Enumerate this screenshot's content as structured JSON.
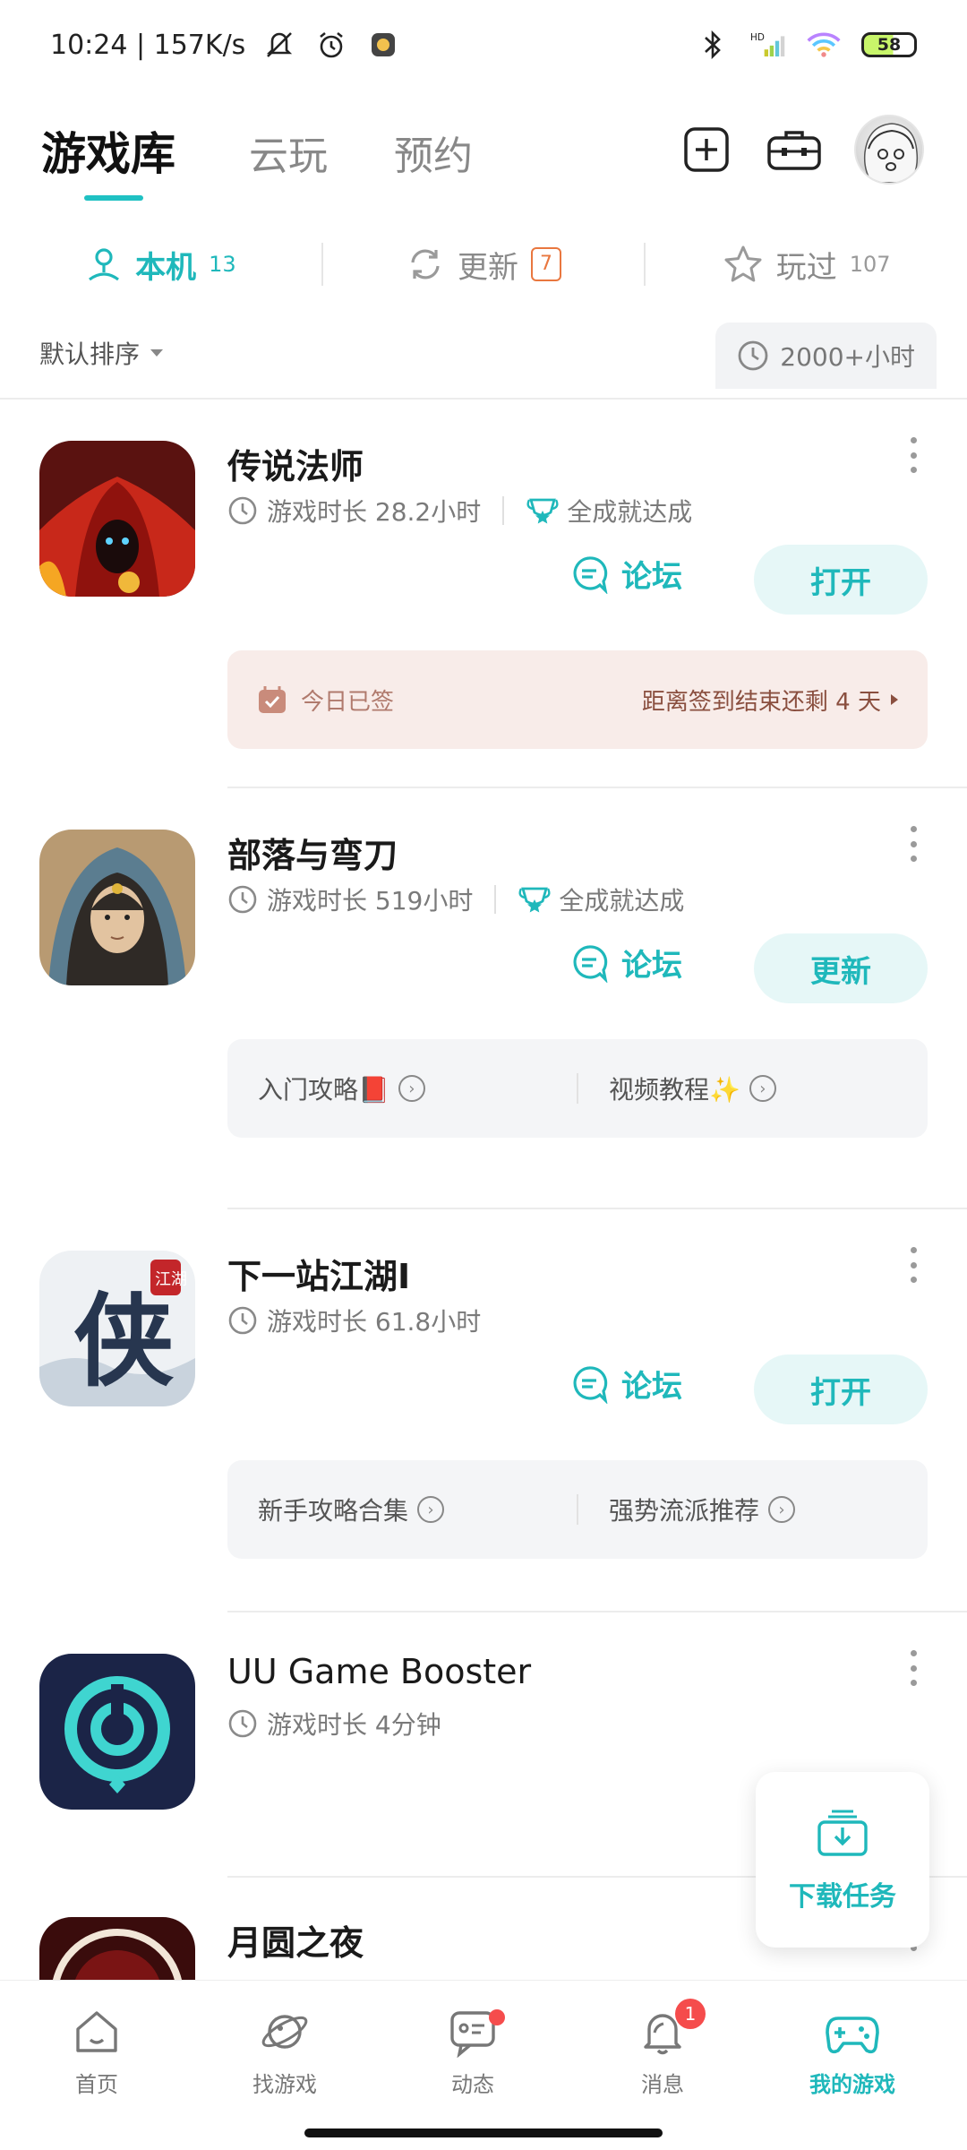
{
  "status": {
    "time_speed": "10:24 | 157K/s",
    "battery": "58"
  },
  "header": {
    "tabs": [
      {
        "label": "游戏库"
      },
      {
        "label": "云玩"
      },
      {
        "label": "预约"
      }
    ]
  },
  "subtabs": {
    "local": {
      "label": "本机",
      "count": "13"
    },
    "update": {
      "label": "更新",
      "count": "7"
    },
    "played": {
      "label": "玩过",
      "count": "107"
    }
  },
  "sort": {
    "label": "默认排序",
    "total_time": "2000+小时"
  },
  "games": [
    {
      "name": "传说法师",
      "playtime": "游戏时长 28.2小时",
      "achievement": "全成就达成",
      "forum": "论坛",
      "action": "打开",
      "sign_left": "今日已签",
      "sign_right": "距离签到结束还剩 4 天"
    },
    {
      "name": "部落与弯刀",
      "playtime": "游戏时长 519小时",
      "achievement": "全成就达成",
      "forum": "论坛",
      "action": "更新",
      "guide_left": "入门攻略📕",
      "guide_right": "视频教程✨"
    },
    {
      "name": "下一站江湖Ⅰ",
      "playtime": "游戏时长 61.8小时",
      "forum": "论坛",
      "action": "打开",
      "guide_left": "新手攻略合集",
      "guide_right": "强势流派推荐"
    },
    {
      "name": "UU Game Booster",
      "playtime": "游戏时长 4分钟"
    },
    {
      "name": "月圆之夜"
    }
  ],
  "fab": {
    "label": "下载任务"
  },
  "nav": {
    "home": "首页",
    "find": "找游戏",
    "feed": "动态",
    "msg": "消息",
    "msg_badge": "1",
    "mine": "我的游戏"
  },
  "colors": {
    "accent": "#1fb8bb",
    "badge": "#e9773f",
    "alert": "#f54c4c"
  }
}
